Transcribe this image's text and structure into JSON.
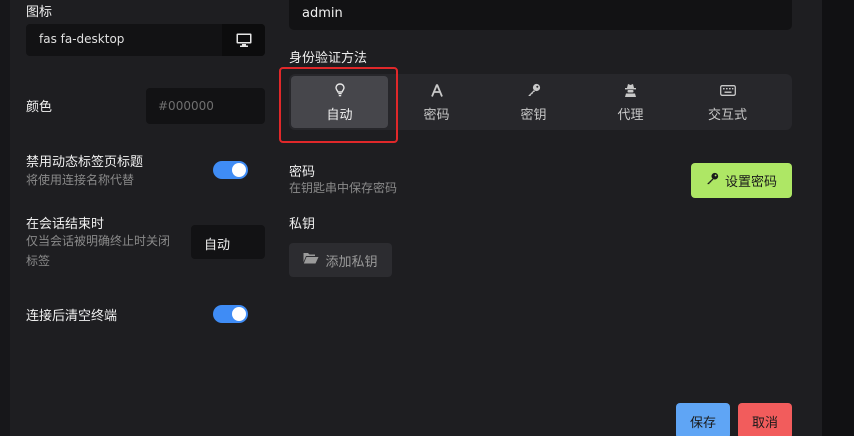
{
  "left": {
    "icon_label": "图标",
    "icon_value": "fas fa-desktop",
    "color_label": "颜色",
    "color_placeholder": "#000000",
    "disable_tab_title_label": "禁用动态标签页标题",
    "disable_tab_title_desc": "将使用连接名称代替",
    "session_end_label": "在会话结束时",
    "session_end_desc_line1": "仅当会话被明确终止时关闭",
    "session_end_desc_line2": "标签",
    "session_end_value": "自动",
    "clear_terminal_label": "连接后清空终端"
  },
  "right": {
    "username_value": "admin",
    "auth_method_label": "身份验证方法",
    "auth_methods": [
      {
        "label": "自动",
        "icon": "lightbulb-icon",
        "active": true
      },
      {
        "label": "密码",
        "icon": "font-icon",
        "active": false
      },
      {
        "label": "密钥",
        "icon": "key-icon",
        "active": false
      },
      {
        "label": "代理",
        "icon": "user-secret-icon",
        "active": false
      },
      {
        "label": "交互式",
        "icon": "keyboard-icon",
        "active": false
      }
    ],
    "password_label": "密码",
    "password_desc": "在钥匙串中保存密码",
    "set_password_button": "设置密码",
    "private_key_label": "私钥",
    "add_private_key_button": "添加私钥"
  },
  "footer": {
    "save_button": "保存",
    "cancel_button": "取消"
  },
  "colors": {
    "accent_blue": "#3f8cf5",
    "set_password_green": "#aee765",
    "save_blue": "#5fa5f5",
    "cancel_red": "#f25c5c",
    "highlight_red": "#e0282a"
  }
}
